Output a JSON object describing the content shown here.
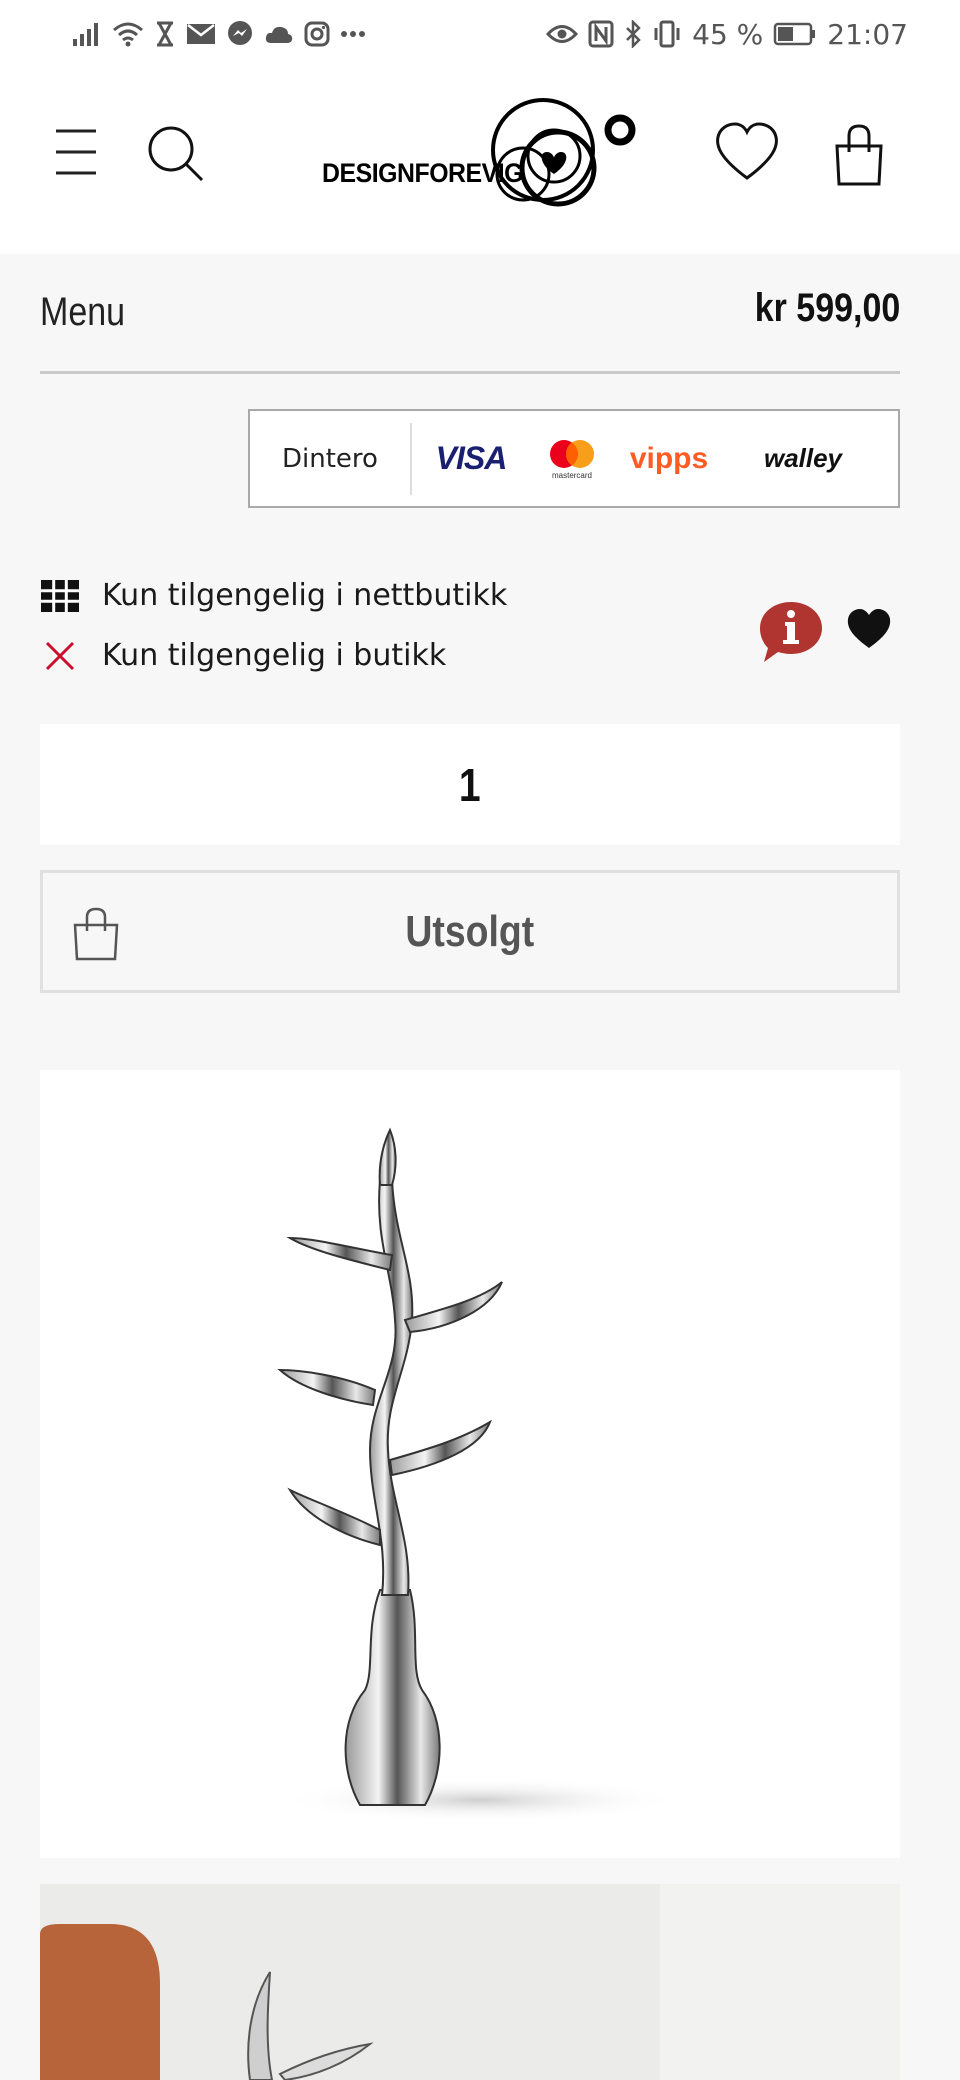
{
  "status_bar": {
    "battery": "45 %",
    "time": "21:07"
  },
  "header": {
    "logo_text": "DESIGNFOREVIG"
  },
  "product": {
    "menu_label": "Menu",
    "price": "kr 599,00",
    "payment_methods": [
      "Dintero",
      "VISA",
      "mastercard",
      "vipps",
      "walley"
    ],
    "availability": [
      {
        "icon": "grid-icon",
        "label": "Kun tilgengelig i nettbutikk"
      },
      {
        "icon": "close-x-icon",
        "label": "Kun tilgengelig i butikk"
      }
    ],
    "quantity": "1",
    "soldout_label": "Utsolgt"
  },
  "colors": {
    "accent_red": "#b0342f",
    "x_red": "#c8102e",
    "page_bg": "#f6f7f6"
  }
}
